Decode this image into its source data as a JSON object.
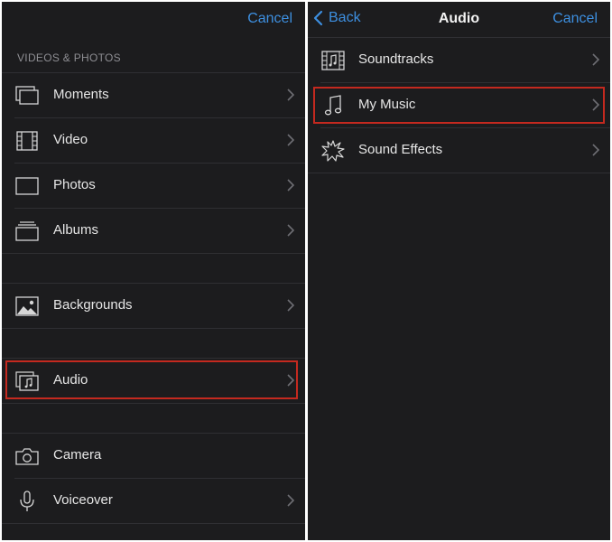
{
  "left": {
    "cancel": "Cancel",
    "section_header": "VIDEOS & PHOTOS",
    "items": [
      {
        "label": "Moments",
        "icon": "moments-icon"
      },
      {
        "label": "Video",
        "icon": "film-icon"
      },
      {
        "label": "Photos",
        "icon": "photo-frame-icon"
      },
      {
        "label": "Albums",
        "icon": "albums-icon"
      },
      {
        "label": "Backgrounds",
        "icon": "landscape-icon"
      },
      {
        "label": "Audio",
        "icon": "audio-icon"
      },
      {
        "label": "Camera",
        "icon": "camera-icon"
      },
      {
        "label": "Voiceover",
        "icon": "microphone-icon"
      }
    ]
  },
  "right": {
    "back": "Back",
    "title": "Audio",
    "cancel": "Cancel",
    "items": [
      {
        "label": "Soundtracks",
        "icon": "soundtrack-film-icon"
      },
      {
        "label": "My Music",
        "icon": "music-note-icon"
      },
      {
        "label": "Sound Effects",
        "icon": "burst-icon"
      }
    ]
  },
  "colors": {
    "background": "#1c1c1e",
    "accent": "#3d8fe0",
    "highlight": "#c4291f"
  }
}
